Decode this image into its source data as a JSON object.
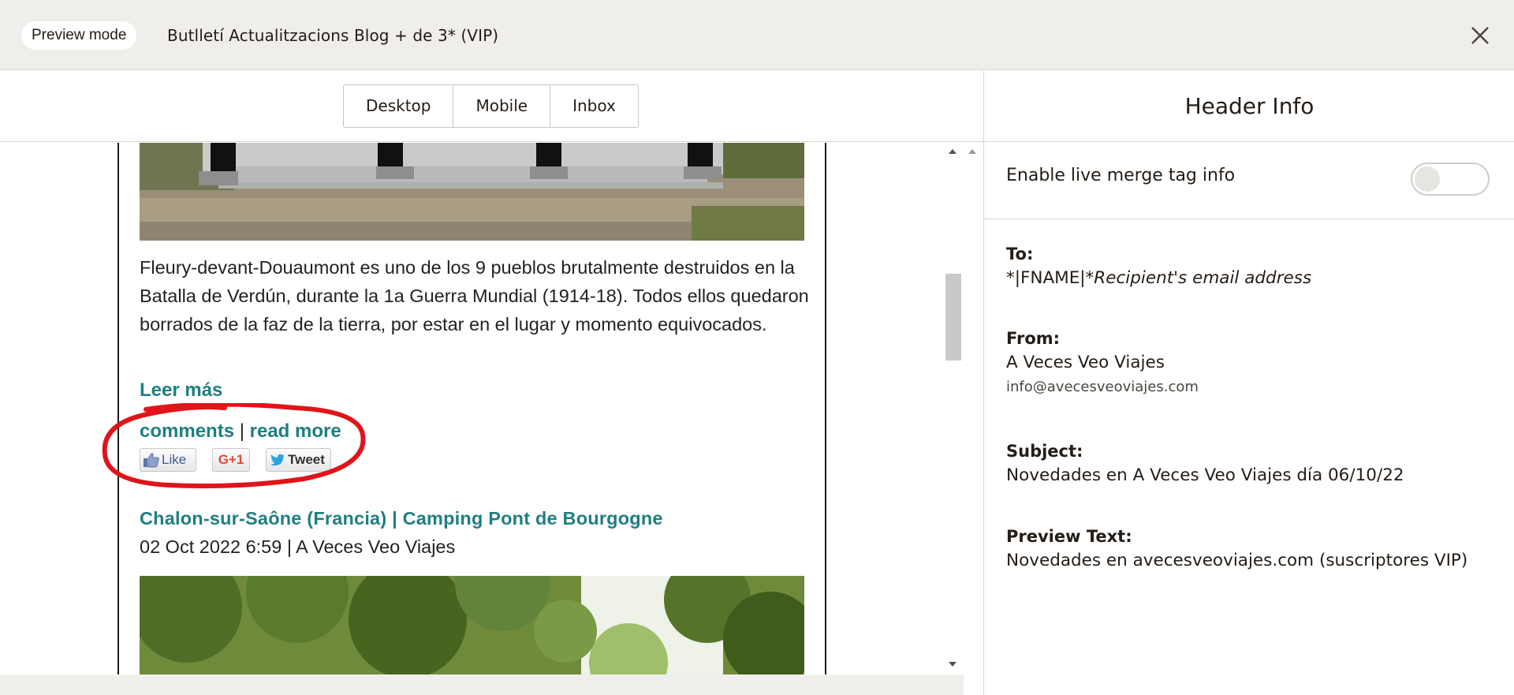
{
  "topbar": {
    "mode_label": "Preview mode",
    "campaign_title": "Butlletí Actualitzacions Blog + de 3* (VIP)",
    "close_icon": "close-icon"
  },
  "view_tabs": [
    {
      "label": "Desktop"
    },
    {
      "label": "Mobile"
    },
    {
      "label": "Inbox"
    }
  ],
  "email": {
    "post1": {
      "excerpt": "Fleury-devant-Douaumont es uno de los 9 pueblos brutalmente destruidos en la Batalla de Verdún, durante la 1a Guerra Mundial (1914-18). Todos ellos quedaron borrados de la faz de la tierra, por estar en el lugar y momento equivocados.",
      "read_more_label": "Leer más",
      "comments_label": "comments",
      "separator": "|",
      "read_more_link": "read more",
      "share": {
        "like": "Like",
        "gplus": "G+1",
        "tweet": "Tweet"
      }
    },
    "post2": {
      "title": "Chalon-sur-Saône (Francia) | Camping Pont de Bourgogne",
      "meta": "02 Oct 2022 6:59 | A Veces Veo Viajes"
    }
  },
  "header_info": {
    "title": "Header Info",
    "merge_toggle_label": "Enable live merge tag info",
    "merge_toggle_on": false,
    "to_label": "To:",
    "to_value": "*|FNAME|*",
    "to_placeholder": "Recipient's email address",
    "from_label": "From:",
    "from_name": "A Veces Veo Viajes",
    "from_email": "info@avecesveoviajes.com",
    "subject_label": "Subject:",
    "subject_value": "Novedades en A Veces Veo Viajes día 06/10/22",
    "preview_label": "Preview Text:",
    "preview_value": "Novedades en avecesveoviajes.com (suscriptores VIP)"
  },
  "colors": {
    "link_teal": "#1e7f80",
    "annotation_red": "#e0141a",
    "topbar_bg": "#efeeea"
  }
}
